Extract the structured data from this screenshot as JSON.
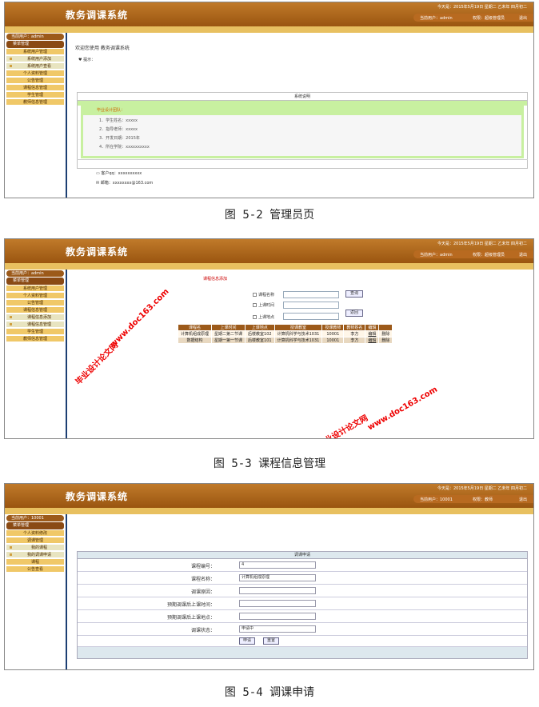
{
  "app": {
    "title": "教务调课系统"
  },
  "shots": [
    {
      "dateline": "今天是：2015年5月19日 星期二 乙未年 四月初二",
      "user_label": "当前用户：admin",
      "role_label": "权限：超级管理员",
      "logout": "退出",
      "current_user": "当前用户：admin",
      "section": "菜单管理",
      "menu": [
        "系统用户管理",
        "系统用户添加",
        "系统用户查看",
        "个人资料管理",
        "公告管理",
        "课程信息管理",
        "学生管理",
        "教师信息管理"
      ],
      "welcome": "欢迎您使用 教务调课系统",
      "tip": "提示：",
      "sys_title": "系统说明",
      "design_header": "毕业设计团队：",
      "design_items": [
        "1．学生姓名：xxxxx",
        "2．指导老师：xxxxx",
        "3．开发日期：2015年",
        "4．所在学院：xxxxxxxxxx"
      ],
      "qq": "客户qq：xxxxxxxxxx",
      "mail": "邮箱：xxxxxxxx@163.com"
    },
    {
      "dateline": "今天是：2015年5月19日 星期二 乙未年 四月初二",
      "user_label": "当前用户：admin",
      "role_label": "权限：超级管理员",
      "logout": "退出",
      "current_user": "当前用户：admin",
      "section": "菜单管理",
      "menu": [
        "系统用户管理",
        "个人资料管理",
        "公告管理",
        "课程信息管理",
        "课程信息添加",
        "课程信息管理",
        "学生管理",
        "教师信息管理"
      ],
      "breadcrumb": "课程信息添加",
      "search_labels": [
        "课程名称",
        "上课时间",
        "上课地点"
      ],
      "query_btn": "查询",
      "back_btn": "返回",
      "table": {
        "headers": [
          "课程名",
          "上课时间",
          "上课地点",
          "授课教室",
          "授课教师",
          "教师姓名",
          "编辑",
          ""
        ],
        "rows": [
          [
            "计算机组成原理",
            "星期二第二节课",
            "后楼教室102",
            "计算机科学与技术1031",
            "10001",
            "李方",
            "编辑",
            "删除"
          ],
          [
            "数据结构",
            "星期一第一节课",
            "后楼教室101",
            "计算机科学与技术1031",
            "10001",
            "李方",
            "编辑",
            "删除"
          ]
        ]
      },
      "watermark_site": "www.doc163.com",
      "watermark_name": "毕业设计论文网"
    },
    {
      "dateline": "今天是：2015年5月19日 星期二 乙未年 四月初二",
      "user_label": "当前用户：10001",
      "role_label": "权限：教师",
      "logout": "退出",
      "current_user": "当前用户：10001",
      "section": "菜单管理",
      "menu": [
        "个人资料修改",
        "调课管理",
        "我的课程",
        "我的调课申请",
        "课程",
        "公告查看"
      ],
      "form_title": "调课申请",
      "fields": [
        {
          "label": "课程编号：",
          "value": "4"
        },
        {
          "label": "课程名称：",
          "value": "计算机组成原理"
        },
        {
          "label": "调课原因：",
          "value": ""
        },
        {
          "label": "预期调课后上课时间：",
          "value": ""
        },
        {
          "label": "预期调课后上课地点：",
          "value": ""
        },
        {
          "label": "调课状态：",
          "value": "申请中"
        }
      ],
      "submit": "申请",
      "reset": "重置"
    }
  ],
  "captions": [
    "图 5-2 管理员页",
    "图 5-3 课程信息管理",
    "图 5-4 调课申请"
  ],
  "colors": {
    "header": "#9a5510",
    "menu": "#f0c868",
    "accent_bar": "#e8c060",
    "green": "#c8f0a0"
  }
}
